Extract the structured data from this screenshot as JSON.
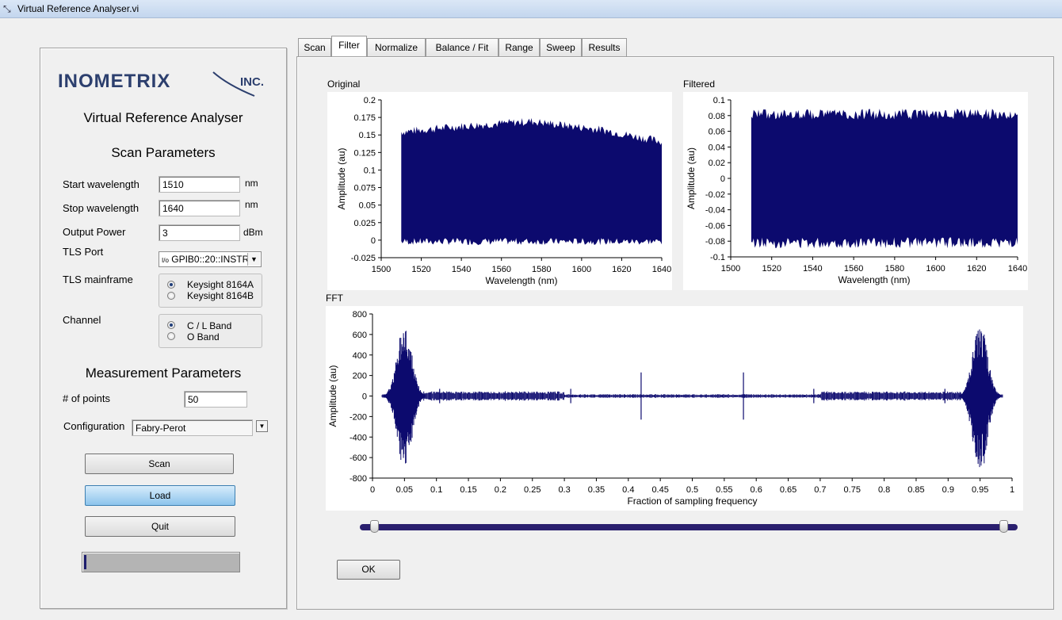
{
  "window": {
    "title": "Virtual Reference Analyser.vi"
  },
  "logo": {
    "text": "INOMETRIX",
    "suffix": "INC."
  },
  "left": {
    "app_title": "Virtual Reference Analyser",
    "scan_params_heading": "Scan Parameters",
    "start_wavelength": {
      "label": "Start wavelength",
      "value": "1510",
      "unit": "nm"
    },
    "stop_wavelength": {
      "label": "Stop wavelength",
      "value": "1640",
      "unit": "nm"
    },
    "output_power": {
      "label": "Output Power",
      "value": "3",
      "unit": "dBm"
    },
    "tls_port": {
      "label": "TLS Port",
      "prefix": "I/o",
      "value": "GPIB0::20::INSTR"
    },
    "tls_mainframe": {
      "label": "TLS mainframe",
      "options": [
        "Keysight 8164A",
        "Keysight 8164B"
      ],
      "selected": 0
    },
    "channel": {
      "label": "Channel",
      "options": [
        "C / L Band",
        "O Band"
      ],
      "selected": 0
    },
    "measurement_heading": "Measurement Parameters",
    "num_points": {
      "label": "# of points",
      "value": "50"
    },
    "configuration": {
      "label": "Configuration",
      "value": "Fabry-Perot"
    },
    "buttons": {
      "scan": "Scan",
      "load": "Load",
      "quit": "Quit"
    },
    "progress": 0.01
  },
  "tabs": [
    {
      "label": "Scan",
      "selected": false
    },
    {
      "label": "Filter",
      "selected": true
    },
    {
      "label": "Normalize",
      "selected": false
    },
    {
      "label": "Balance / Fit",
      "selected": false
    },
    {
      "label": "Range",
      "selected": false
    },
    {
      "label": "Sweep",
      "selected": false
    },
    {
      "label": "Results",
      "selected": false
    }
  ],
  "ok_button": "OK",
  "range_slider": {
    "min": 0,
    "max": 1,
    "low": 0.02,
    "high": 0.98
  },
  "colors": {
    "trace": "#0c0a6e",
    "slider_track": "#2a1f6e"
  },
  "chart_data": [
    {
      "id": "original",
      "type": "line",
      "title": "Original",
      "xlabel": "Wavelength (nm)",
      "ylabel": "Amplitude (au)",
      "xlim": [
        1500,
        1640
      ],
      "ylim": [
        -0.025,
        0.2
      ],
      "xticks": [
        "1500",
        "1520",
        "1540",
        "1560",
        "1580",
        "1600",
        "1620",
        "1640"
      ],
      "yticks": [
        "0.2",
        "0.175",
        "0.15",
        "0.125",
        "0.1",
        "0.075",
        "0.05",
        "0.025",
        "0",
        "-0.025"
      ],
      "signal": {
        "x_start": 1510,
        "x_end": 1640,
        "upper_envelope": [
          [
            1510,
            0.152
          ],
          [
            1540,
            0.16
          ],
          [
            1575,
            0.167
          ],
          [
            1610,
            0.155
          ],
          [
            1640,
            0.138
          ]
        ],
        "lower_envelope": 0.0
      }
    },
    {
      "id": "filtered",
      "type": "line",
      "title": "Filtered",
      "xlabel": "Wavelength (nm)",
      "ylabel": "Amplitude (au)",
      "xlim": [
        1500,
        1640
      ],
      "ylim": [
        -0.1,
        0.1
      ],
      "xticks": [
        "1500",
        "1520",
        "1540",
        "1560",
        "1580",
        "1600",
        "1620",
        "1640"
      ],
      "yticks": [
        "0.1",
        "0.08",
        "0.06",
        "0.04",
        "0.02",
        "0",
        "-0.02",
        "-0.04",
        "-0.06",
        "-0.08",
        "-0.1"
      ],
      "signal": {
        "x_start": 1510,
        "x_end": 1640,
        "amplitude": 0.085
      }
    },
    {
      "id": "fft",
      "type": "line",
      "title": "FFT",
      "xlabel": "Fraction of sampling frequency",
      "ylabel": "Amplitude (au)",
      "xlim": [
        0,
        1
      ],
      "ylim": [
        -800,
        800
      ],
      "xticks": [
        "0",
        "0.05",
        "0.1",
        "0.15",
        "0.2",
        "0.25",
        "0.3",
        "0.35",
        "0.4",
        "0.45",
        "0.5",
        "0.55",
        "0.6",
        "0.65",
        "0.7",
        "0.75",
        "0.8",
        "0.85",
        "0.9",
        "0.95",
        "1"
      ],
      "yticks": [
        "800",
        "600",
        "400",
        "200",
        "0",
        "-200",
        "-400",
        "-600",
        "-800"
      ],
      "peaks": [
        {
          "x": 0.05,
          "amplitude": 720
        },
        {
          "x": 0.95,
          "amplitude": 720
        }
      ],
      "spikes": [
        {
          "x": 0.105,
          "amplitude": 70
        },
        {
          "x": 0.31,
          "amplitude": 70
        },
        {
          "x": 0.42,
          "amplitude": 230
        },
        {
          "x": 0.58,
          "amplitude": 230
        },
        {
          "x": 0.69,
          "amplitude": 70
        },
        {
          "x": 0.895,
          "amplitude": 70
        }
      ]
    }
  ]
}
